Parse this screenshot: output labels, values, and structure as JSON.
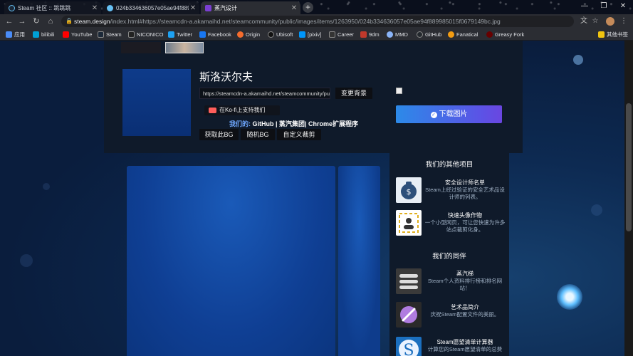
{
  "browser": {
    "tabs": [
      {
        "title": "Steam 社区 :: 跳跳跳",
        "color": "#1b2838",
        "active": false
      },
      {
        "title": "024b334636057e05ae94f8898",
        "color": "#66c0f4",
        "active": false
      },
      {
        "title": "蒸汽设计",
        "color": "#7a3fd1",
        "active": true
      }
    ],
    "url_host": "steam.design",
    "url_rest": "/index.html#https://steamcdn-a.akamaihd.net/steamcommunity/public/images/items/1263950/024b334636057e05ae94f889985015f0679149bc.jpg",
    "bookmarks": [
      {
        "label": "应用",
        "color": "#4a8cf7"
      },
      {
        "label": "bilibili",
        "color": "#00a1d6"
      },
      {
        "label": "YouTube",
        "color": "#ff0000"
      },
      {
        "label": "Steam",
        "color": "#1b2838"
      },
      {
        "label": "NICONICO",
        "color": "#222222"
      },
      {
        "label": "Twitter",
        "color": "#1da1f2"
      },
      {
        "label": "Facebook",
        "color": "#1877f2"
      },
      {
        "label": "Origin",
        "color": "#f56c2d"
      },
      {
        "label": "Ubisoft",
        "color": "#111111"
      },
      {
        "label": "[pixiv]",
        "color": "#0096fa"
      },
      {
        "label": "Career",
        "color": "#333333"
      },
      {
        "label": "9dm",
        "color": "#c0392b"
      },
      {
        "label": "MMD",
        "color": "#8ab4f8"
      },
      {
        "label": "GitHub",
        "color": "#24292e"
      },
      {
        "label": "Fanatical",
        "color": "#f39c12"
      },
      {
        "label": "Greasy Fork",
        "color": "#670000"
      },
      {
        "label": "其他书签",
        "color": "#f1c40f"
      }
    ]
  },
  "profile": {
    "username": "斯洛沃尔夫",
    "url_value": "https://steamcdn-a.akamaihd.net/steamcommunity/pul",
    "change_bg_label": "变更背景",
    "kofi_label": "在Ko-fi上支持我们",
    "our_label": "我们的:",
    "links_text": "GitHub | 蒸汽集团| Chrome扩展程序",
    "get_bg_label": "获取此BG",
    "random_bg_label": "随机BG",
    "custom_crop_label": "自定义裁剪",
    "download_label": "下载图片"
  },
  "sidebar": {
    "other_projects_title": "我们的其他项目",
    "projects": [
      {
        "name": "安全设计师名单",
        "desc": "Steam上经过验证的安全艺术品设计师的列表。",
        "color": "#e8eef5"
      },
      {
        "name": "快速头像作物",
        "desc": "一个小型网页，可让您快速为许多站点裁剪化身。",
        "color": "#ffffff"
      }
    ],
    "peers_title": "我们的同伴",
    "peers": [
      {
        "name": "蒸汽梯",
        "desc": "Steam个人资料排行榜和排名网站！",
        "color": "#3a3a3a"
      },
      {
        "name": "艺术品简介",
        "desc": "庆祝Steam配置文件的美丽。",
        "color": "#2a2a2a"
      },
      {
        "name": "Steam愿望清单计算器",
        "desc": "计算您的Steam愿望清单的总费",
        "color": "#1b6fbf"
      }
    ]
  }
}
